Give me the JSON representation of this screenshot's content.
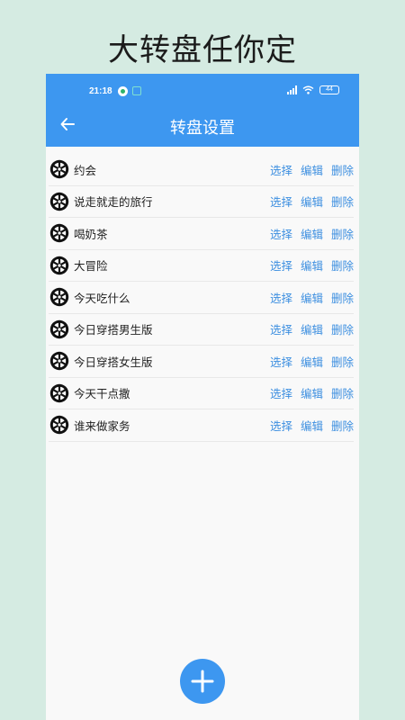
{
  "banner": {
    "title": "大转盘任你定"
  },
  "status_bar": {
    "time": "21:18",
    "battery": "44"
  },
  "header": {
    "title": "转盘设置"
  },
  "actions": {
    "select": "选择",
    "edit": "编辑",
    "delete": "删除"
  },
  "items": [
    {
      "name": "约会"
    },
    {
      "name": "说走就走的旅行"
    },
    {
      "name": "喝奶茶"
    },
    {
      "name": "大冒险"
    },
    {
      "name": "今天吃什么"
    },
    {
      "name": "今日穿搭男生版"
    },
    {
      "name": "今日穿搭女生版"
    },
    {
      "name": "今天干点撒"
    },
    {
      "name": "谁来做家务"
    }
  ],
  "colors": {
    "accent": "#3d97f0",
    "action_text": "#3d8fe0",
    "background": "#d5ebe2"
  },
  "icons": {
    "item": "wheel-icon",
    "back": "arrow-left-icon",
    "add": "plus-icon"
  }
}
